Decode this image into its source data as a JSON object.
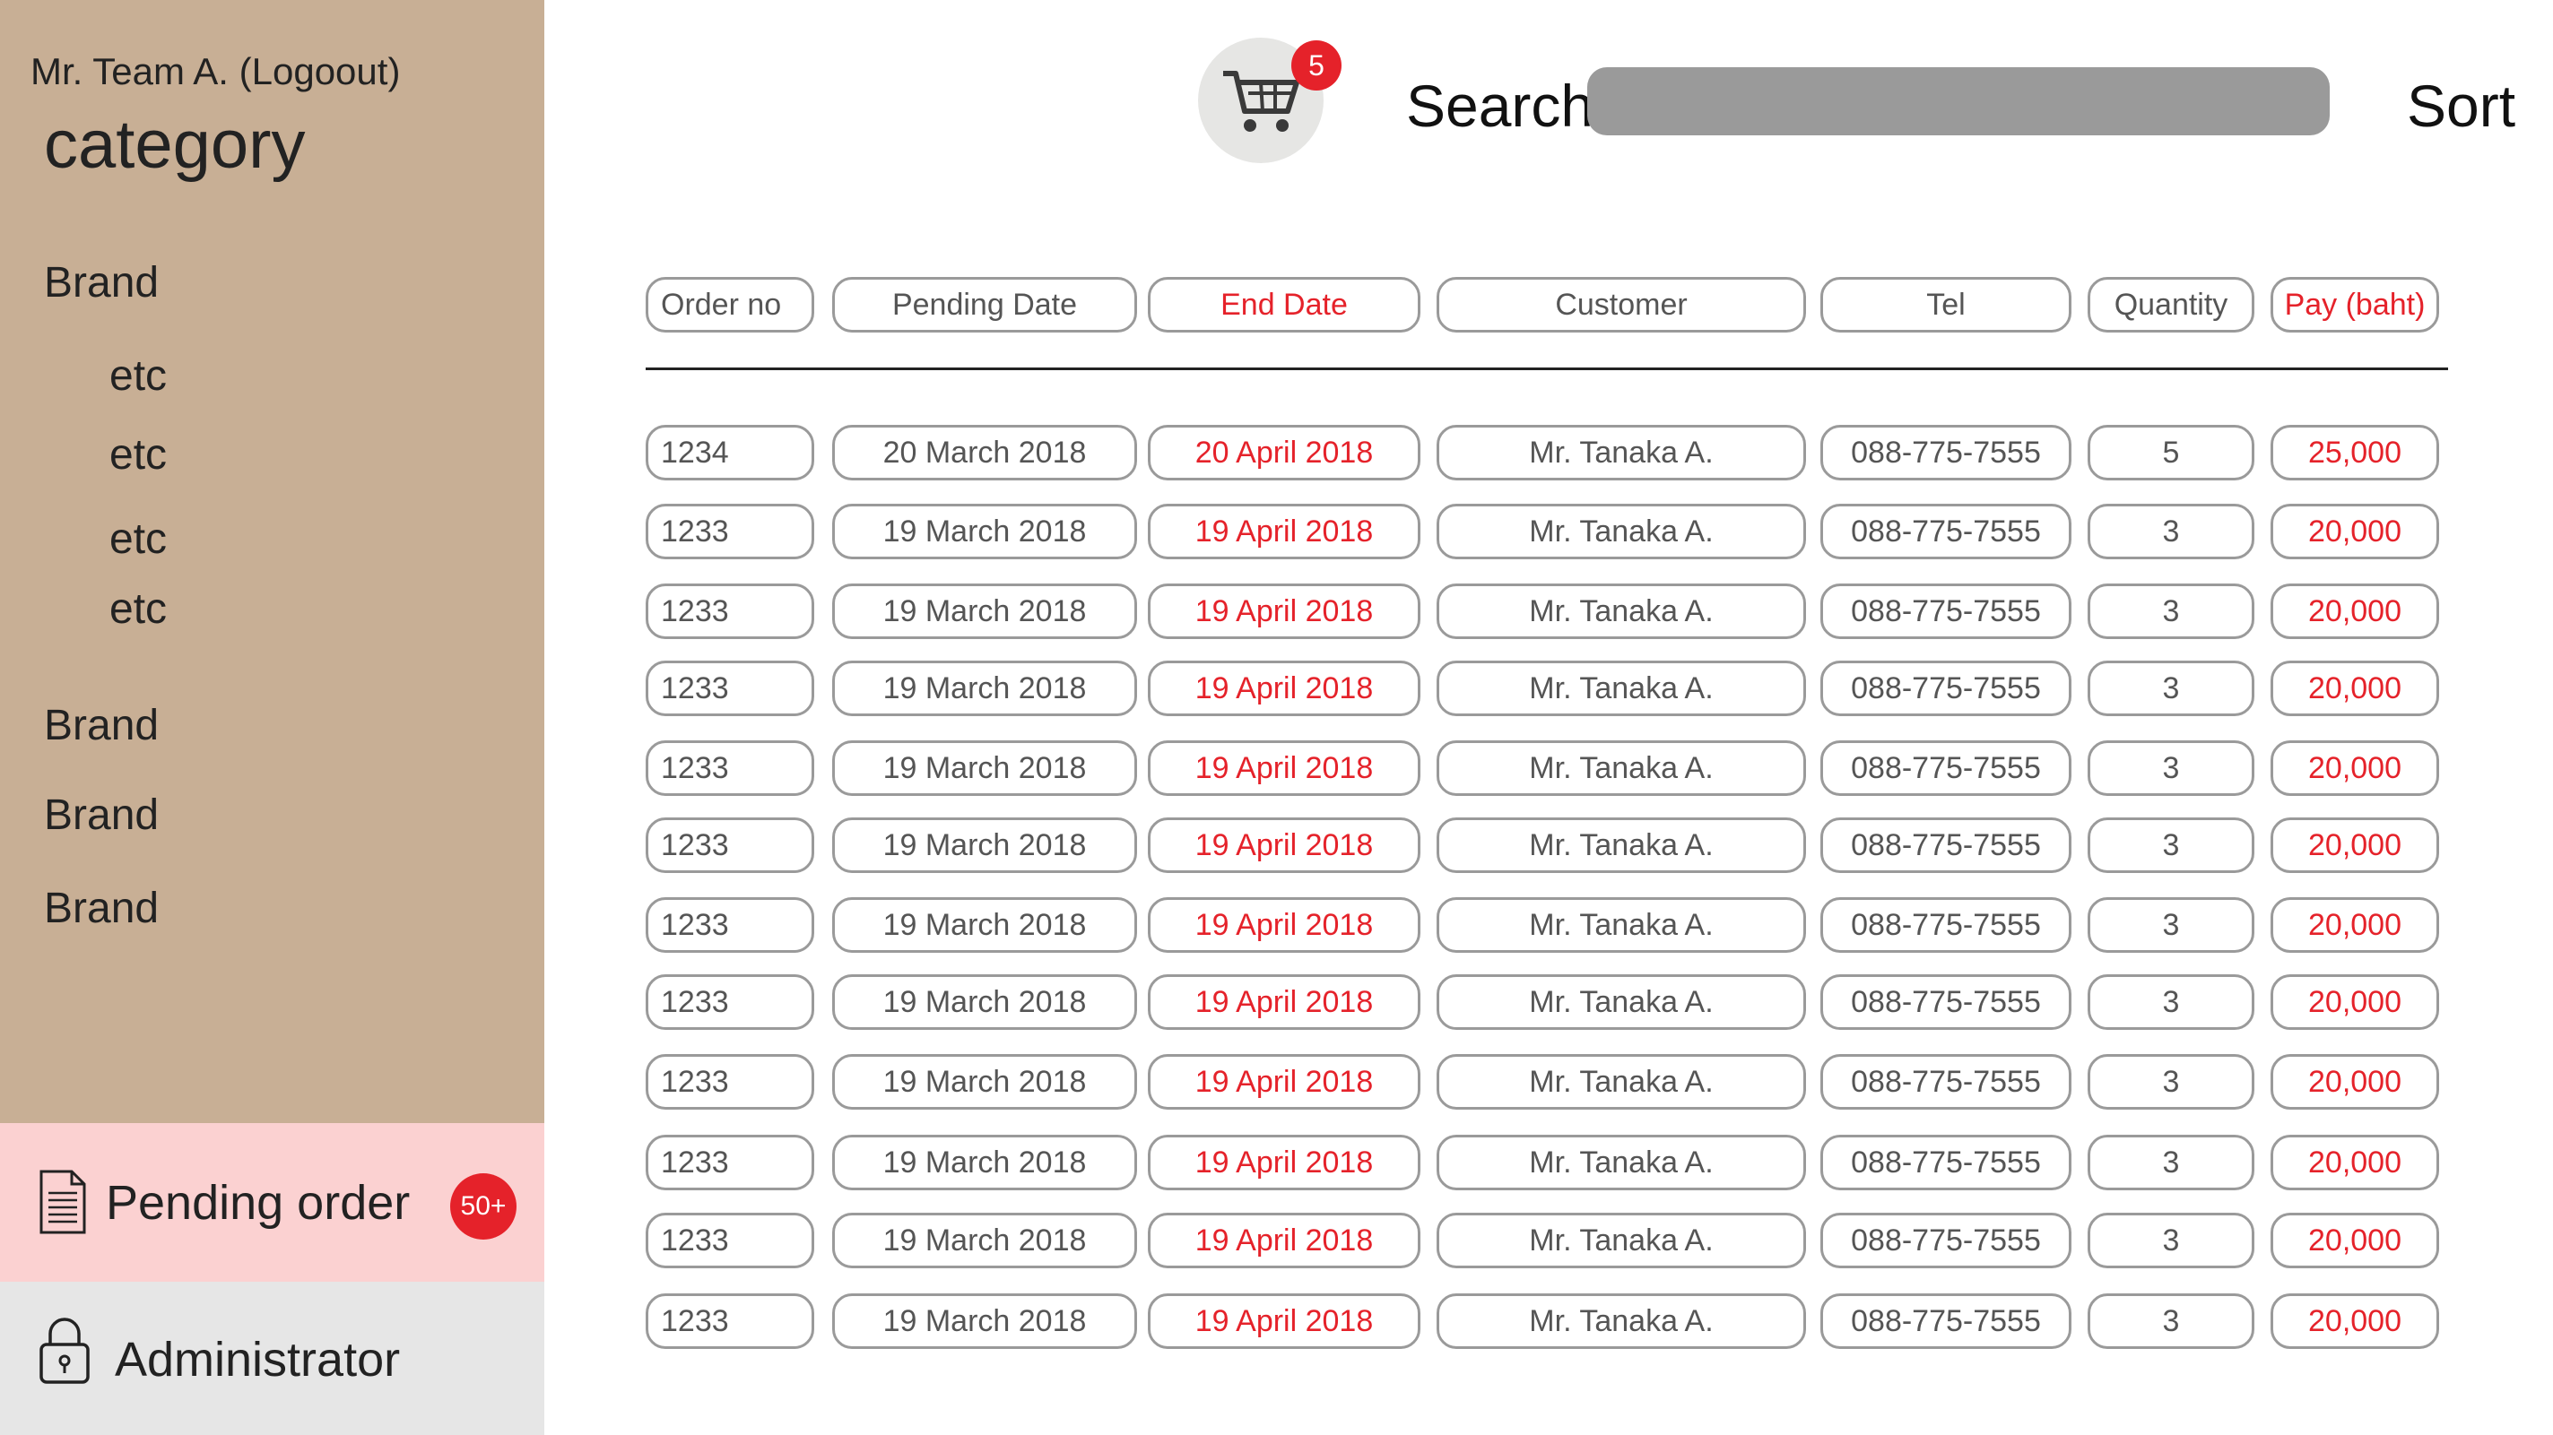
{
  "sidebar": {
    "user_line": "Mr. Team A. (Logoout)",
    "category_title": "category",
    "items": [
      {
        "label": "Brand"
      },
      {
        "label": "etc"
      },
      {
        "label": "etc"
      },
      {
        "label": "etc"
      },
      {
        "label": "etc"
      },
      {
        "label": "Brand"
      },
      {
        "label": "Brand"
      },
      {
        "label": "Brand"
      }
    ],
    "pending": {
      "label": "Pending order",
      "badge": "50+",
      "icon": "document-icon"
    },
    "admin": {
      "label": "Administrator",
      "icon": "lock-icon"
    }
  },
  "header": {
    "cart_badge": "5",
    "cart_icon": "cart-icon",
    "search_label": "Search",
    "search_value": "",
    "sort_label": "Sort"
  },
  "table": {
    "columns": [
      "Order no",
      "Pending Date",
      "End Date",
      "Customer",
      "Tel",
      "Quantity",
      "Pay (baht)"
    ],
    "rows": [
      [
        "1234",
        "20 March 2018",
        "20 April 2018",
        "Mr. Tanaka A.",
        "088-775-7555",
        "5",
        "25,000"
      ],
      [
        "1233",
        "19 March 2018",
        "19 April 2018",
        "Mr. Tanaka A.",
        "088-775-7555",
        "3",
        "20,000"
      ],
      [
        "1233",
        "19 March 2018",
        "19 April 2018",
        "Mr. Tanaka A.",
        "088-775-7555",
        "3",
        "20,000"
      ],
      [
        "1233",
        "19 March 2018",
        "19 April 2018",
        "Mr. Tanaka A.",
        "088-775-7555",
        "3",
        "20,000"
      ],
      [
        "1233",
        "19 March 2018",
        "19 April 2018",
        "Mr. Tanaka A.",
        "088-775-7555",
        "3",
        "20,000"
      ],
      [
        "1233",
        "19 March 2018",
        "19 April 2018",
        "Mr. Tanaka A.",
        "088-775-7555",
        "3",
        "20,000"
      ],
      [
        "1233",
        "19 March 2018",
        "19 April 2018",
        "Mr. Tanaka A.",
        "088-775-7555",
        "3",
        "20,000"
      ],
      [
        "1233",
        "19 March 2018",
        "19 April 2018",
        "Mr. Tanaka A.",
        "088-775-7555",
        "3",
        "20,000"
      ],
      [
        "1233",
        "19 March 2018",
        "19 April 2018",
        "Mr. Tanaka A.",
        "088-775-7555",
        "3",
        "20,000"
      ],
      [
        "1233",
        "19 March 2018",
        "19 April 2018",
        "Mr. Tanaka A.",
        "088-775-7555",
        "3",
        "20,000"
      ],
      [
        "1233",
        "19 March 2018",
        "19 April 2018",
        "Mr. Tanaka A.",
        "088-775-7555",
        "3",
        "20,000"
      ],
      [
        "1233",
        "19 March 2018",
        "19 April 2018",
        "Mr. Tanaka A.",
        "088-775-7555",
        "3",
        "20,000"
      ]
    ]
  },
  "colors": {
    "sidebar_bg": "#c8af95",
    "pending_bg": "#fbd1d1",
    "admin_bg": "#e6e6e6",
    "accent_red": "#e5222a",
    "pill_border": "#9a9a9a",
    "search_bg": "#9a9a9a"
  }
}
